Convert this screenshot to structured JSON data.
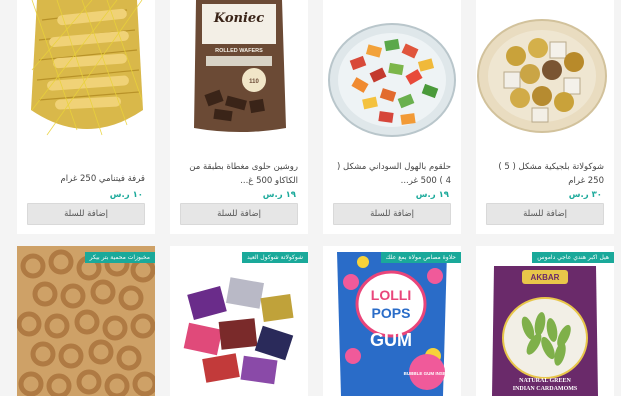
{
  "colors": {
    "accent": "#1aa99a",
    "button_bg": "#e6e6e6",
    "page_bg": "#f4f4f4"
  },
  "products_top": [
    {
      "name": "قرفة فيتنامي 250 غرام",
      "price": "١٠ ر.س",
      "button": "إضافة للسلة"
    },
    {
      "name": "روشين حلوى مغطاة بطبقة من الكاكاو 500 غ...",
      "price": "١٩ ر.س",
      "button": "إضافة للسلة",
      "package_text": {
        "brand": "Koniec",
        "line1": "ROLLED WAFERS",
        "weight": "110"
      }
    },
    {
      "name": "حلقوم بالهول السوداني مشكل ( 4 ) 500 غر...",
      "price": "١٩ ر.س",
      "button": "إضافة للسلة"
    },
    {
      "name": "شوكولاتة بلجيكية مشكل ( 5 ) 250 غرام",
      "price": "٣٠ ر.س",
      "button": "إضافة للسلة"
    }
  ],
  "products_bottom": [
    {
      "badge": "مخبوزات محمية بتر بيكر"
    },
    {
      "badge": "شوكولاتة شوكول العيد"
    },
    {
      "badge": "حلاوة مصاص مولاه بمع علك",
      "package_text": {
        "lolli": "LOLLI",
        "pops": "POPS",
        "gum": "GUM",
        "bubble": "BUBBLE GUM INSIDE"
      }
    },
    {
      "badge": "هيل اكبر هندي عاجي داموس",
      "package_text": {
        "brand": "AKBAR",
        "line1": "NATURAL GREEN",
        "line2": "INDIAN CARDAMOMS"
      }
    }
  ]
}
